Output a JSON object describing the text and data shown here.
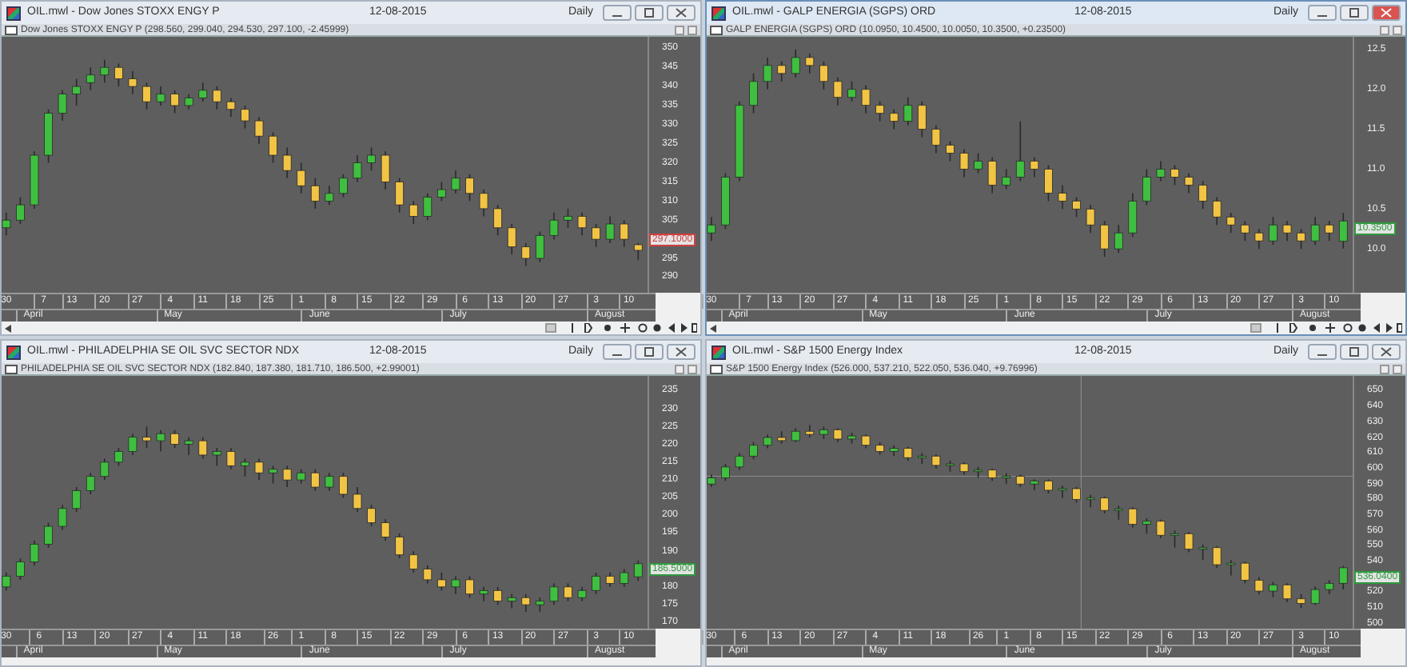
{
  "windows": [
    {
      "title": "OIL.mwl - Dow Jones STOXX ENGY P",
      "date": "12-08-2015",
      "period": "Daily",
      "active": false,
      "series_label": "Dow Jones STOXX ENGY P (298.560, 299.040, 294.530, 297.100, -2.45999)",
      "last_price": "297.1000",
      "chart_data": {
        "type": "candlestick",
        "xlim": [
          "2015-03-29",
          "2015-08-14"
        ],
        "ylim": [
          286,
          353
        ],
        "yticks": [
          {
            "value": 350,
            "label": "350"
          },
          {
            "value": 345,
            "label": "345"
          },
          {
            "value": 340,
            "label": "340"
          },
          {
            "value": 335,
            "label": "335"
          },
          {
            "value": 330,
            "label": "330"
          },
          {
            "value": 325,
            "label": "325"
          },
          {
            "value": 320,
            "label": "320"
          },
          {
            "value": 315,
            "label": "315"
          },
          {
            "value": 310,
            "label": "310"
          },
          {
            "value": 305,
            "label": "305"
          },
          {
            "value": 295,
            "label": "295"
          },
          {
            "value": 290,
            "label": "290"
          }
        ],
        "xticks": [
          {
            "value": "2015-03-30",
            "label": "30"
          },
          {
            "value": "2015-04-07",
            "label": "7"
          },
          {
            "value": "2015-04-13",
            "label": "13"
          },
          {
            "value": "2015-04-20",
            "label": "20"
          },
          {
            "value": "2015-04-27",
            "label": "27"
          },
          {
            "value": "2015-05-04",
            "label": "4"
          },
          {
            "value": "2015-05-11",
            "label": "11"
          },
          {
            "value": "2015-05-18",
            "label": "18"
          },
          {
            "value": "2015-05-25",
            "label": "25"
          },
          {
            "value": "2015-06-01",
            "label": "1"
          },
          {
            "value": "2015-06-08",
            "label": "8"
          },
          {
            "value": "2015-06-15",
            "label": "15"
          },
          {
            "value": "2015-06-22",
            "label": "22"
          },
          {
            "value": "2015-06-29",
            "label": "29"
          },
          {
            "value": "2015-07-06",
            "label": "6"
          },
          {
            "value": "2015-07-13",
            "label": "13"
          },
          {
            "value": "2015-07-20",
            "label": "20"
          },
          {
            "value": "2015-07-27",
            "label": "27"
          },
          {
            "value": "2015-08-03",
            "label": "3"
          },
          {
            "value": "2015-08-10",
            "label": "10"
          }
        ],
        "x": [
          "2015-03-30",
          "2015-04-02",
          "2015-04-05",
          "2015-04-08",
          "2015-04-11",
          "2015-04-14",
          "2015-04-17",
          "2015-04-20",
          "2015-04-23",
          "2015-04-26",
          "2015-04-29",
          "2015-05-02",
          "2015-05-05",
          "2015-05-08",
          "2015-05-11",
          "2015-05-14",
          "2015-05-17",
          "2015-05-20",
          "2015-05-23",
          "2015-05-26",
          "2015-05-29",
          "2015-06-01",
          "2015-06-04",
          "2015-06-07",
          "2015-06-10",
          "2015-06-13",
          "2015-06-16",
          "2015-06-19",
          "2015-06-22",
          "2015-06-25",
          "2015-06-28",
          "2015-07-01",
          "2015-07-04",
          "2015-07-07",
          "2015-07-10",
          "2015-07-13",
          "2015-07-16",
          "2015-07-19",
          "2015-07-22",
          "2015-07-25",
          "2015-07-28",
          "2015-07-31",
          "2015-08-03",
          "2015-08-06",
          "2015-08-09",
          "2015-08-12"
        ],
        "ohlc": [
          [
            303,
            307,
            301,
            305
          ],
          [
            305,
            311,
            304,
            309
          ],
          [
            309,
            323,
            308,
            322
          ],
          [
            322,
            334,
            320,
            333
          ],
          [
            333,
            339,
            331,
            338
          ],
          [
            338,
            342,
            335,
            340
          ],
          [
            341,
            345,
            339,
            343
          ],
          [
            343,
            347,
            341,
            345
          ],
          [
            345,
            346,
            340,
            342
          ],
          [
            342,
            344,
            338,
            340
          ],
          [
            340,
            341,
            334,
            336
          ],
          [
            336,
            340,
            335,
            338
          ],
          [
            338,
            339,
            333,
            335
          ],
          [
            335,
            338,
            334,
            337
          ],
          [
            337,
            341,
            336,
            339
          ],
          [
            339,
            340,
            334,
            336
          ],
          [
            336,
            337,
            332,
            334
          ],
          [
            334,
            335,
            329,
            331
          ],
          [
            331,
            332,
            325,
            327
          ],
          [
            327,
            328,
            320,
            322
          ],
          [
            322,
            324,
            316,
            318
          ],
          [
            318,
            320,
            312,
            314
          ],
          [
            314,
            316,
            308,
            310
          ],
          [
            310,
            314,
            309,
            312
          ],
          [
            312,
            317,
            311,
            316
          ],
          [
            316,
            322,
            315,
            320
          ],
          [
            320,
            324,
            318,
            322
          ],
          [
            322,
            323,
            313,
            315
          ],
          [
            315,
            316,
            307,
            309
          ],
          [
            309,
            310,
            304,
            306
          ],
          [
            306,
            312,
            305,
            311
          ],
          [
            311,
            315,
            310,
            313
          ],
          [
            313,
            318,
            312,
            316
          ],
          [
            316,
            317,
            310,
            312
          ],
          [
            312,
            313,
            306,
            308
          ],
          [
            308,
            309,
            301,
            303
          ],
          [
            303,
            304,
            296,
            298
          ],
          [
            298,
            299,
            293,
            295
          ],
          [
            295,
            302,
            294,
            301
          ],
          [
            301,
            307,
            300,
            305
          ],
          [
            305,
            308,
            303,
            306
          ],
          [
            306,
            307,
            301,
            303
          ],
          [
            303,
            304,
            298,
            300
          ],
          [
            300,
            306,
            299,
            304
          ],
          [
            304,
            305,
            298,
            300
          ],
          [
            298.56,
            299.04,
            294.53,
            297.1
          ]
        ]
      },
      "months": [
        "April",
        "May",
        "June",
        "July",
        "August"
      ]
    },
    {
      "title": "OIL.mwl - GALP ENERGIA (SGPS) ORD",
      "date": "12-08-2015",
      "period": "Daily",
      "active": true,
      "series_label": "GALP ENERGIA (SGPS) ORD (10.0950, 10.4500, 10.0050, 10.3500, +0.23500)",
      "last_price": "10.3500",
      "chart_data": {
        "type": "candlestick",
        "xlim": [
          "2015-03-29",
          "2015-08-14"
        ],
        "ylim": [
          9.45,
          12.66
        ],
        "yticks": [
          {
            "value": 12.5,
            "label": "12.5"
          },
          {
            "value": 12,
            "label": "12.0"
          },
          {
            "value": 11.5,
            "label": "11.5"
          },
          {
            "value": 11,
            "label": "11.0"
          },
          {
            "value": 10.5,
            "label": "10.5"
          },
          {
            "value": 10,
            "label": "10.0"
          }
        ],
        "xticks": [
          {
            "value": "2015-03-30",
            "label": "30"
          },
          {
            "value": "2015-04-07",
            "label": "7"
          },
          {
            "value": "2015-04-13",
            "label": "13"
          },
          {
            "value": "2015-04-20",
            "label": "20"
          },
          {
            "value": "2015-04-27",
            "label": "27"
          },
          {
            "value": "2015-05-04",
            "label": "4"
          },
          {
            "value": "2015-05-11",
            "label": "11"
          },
          {
            "value": "2015-05-18",
            "label": "18"
          },
          {
            "value": "2015-05-25",
            "label": "25"
          },
          {
            "value": "2015-06-01",
            "label": "1"
          },
          {
            "value": "2015-06-08",
            "label": "8"
          },
          {
            "value": "2015-06-15",
            "label": "15"
          },
          {
            "value": "2015-06-22",
            "label": "22"
          },
          {
            "value": "2015-06-29",
            "label": "29"
          },
          {
            "value": "2015-07-06",
            "label": "6"
          },
          {
            "value": "2015-07-13",
            "label": "13"
          },
          {
            "value": "2015-07-20",
            "label": "20"
          },
          {
            "value": "2015-07-27",
            "label": "27"
          },
          {
            "value": "2015-08-03",
            "label": "3"
          },
          {
            "value": "2015-08-10",
            "label": "10"
          }
        ],
        "x": [
          "2015-03-30",
          "2015-04-02",
          "2015-04-05",
          "2015-04-08",
          "2015-04-11",
          "2015-04-14",
          "2015-04-17",
          "2015-04-20",
          "2015-04-23",
          "2015-04-26",
          "2015-04-29",
          "2015-05-02",
          "2015-05-05",
          "2015-05-08",
          "2015-05-11",
          "2015-05-14",
          "2015-05-17",
          "2015-05-20",
          "2015-05-23",
          "2015-05-26",
          "2015-05-29",
          "2015-06-01",
          "2015-06-04",
          "2015-06-07",
          "2015-06-10",
          "2015-06-13",
          "2015-06-16",
          "2015-06-19",
          "2015-06-22",
          "2015-06-25",
          "2015-06-28",
          "2015-07-01",
          "2015-07-04",
          "2015-07-07",
          "2015-07-10",
          "2015-07-13",
          "2015-07-16",
          "2015-07-19",
          "2015-07-22",
          "2015-07-25",
          "2015-07-28",
          "2015-07-31",
          "2015-08-03",
          "2015-08-06",
          "2015-08-09",
          "2015-08-12"
        ],
        "ohlc": [
          [
            10.2,
            10.4,
            10.1,
            10.3
          ],
          [
            10.3,
            10.95,
            10.25,
            10.9
          ],
          [
            10.9,
            11.85,
            10.85,
            11.8
          ],
          [
            11.8,
            12.2,
            11.7,
            12.1
          ],
          [
            12.1,
            12.4,
            12.0,
            12.3
          ],
          [
            12.3,
            12.35,
            12.1,
            12.2
          ],
          [
            12.2,
            12.5,
            12.15,
            12.4
          ],
          [
            12.4,
            12.45,
            12.2,
            12.3
          ],
          [
            12.3,
            12.35,
            12.0,
            12.1
          ],
          [
            12.1,
            12.15,
            11.8,
            11.9
          ],
          [
            11.9,
            12.1,
            11.85,
            12.0
          ],
          [
            12.0,
            12.05,
            11.7,
            11.8
          ],
          [
            11.8,
            11.85,
            11.6,
            11.7
          ],
          [
            11.7,
            11.75,
            11.5,
            11.6
          ],
          [
            11.6,
            11.9,
            11.55,
            11.8
          ],
          [
            11.8,
            11.85,
            11.4,
            11.5
          ],
          [
            11.5,
            11.55,
            11.2,
            11.3
          ],
          [
            11.3,
            11.35,
            11.1,
            11.2
          ],
          [
            11.2,
            11.25,
            10.9,
            11.0
          ],
          [
            11.0,
            11.2,
            10.95,
            11.1
          ],
          [
            11.1,
            11.15,
            10.7,
            10.8
          ],
          [
            10.8,
            11.0,
            10.75,
            10.9
          ],
          [
            10.9,
            11.6,
            10.85,
            11.1
          ],
          [
            11.1,
            11.15,
            10.9,
            11.0
          ],
          [
            11.0,
            11.05,
            10.6,
            10.7
          ],
          [
            10.7,
            10.8,
            10.5,
            10.6
          ],
          [
            10.6,
            10.65,
            10.4,
            10.5
          ],
          [
            10.5,
            10.55,
            10.2,
            10.3
          ],
          [
            10.3,
            10.35,
            9.9,
            10.0
          ],
          [
            10.0,
            10.3,
            9.95,
            10.2
          ],
          [
            10.2,
            10.7,
            10.15,
            10.6
          ],
          [
            10.6,
            11.0,
            10.55,
            10.9
          ],
          [
            10.9,
            11.1,
            10.85,
            11.0
          ],
          [
            11.0,
            11.05,
            10.8,
            10.9
          ],
          [
            10.9,
            10.95,
            10.7,
            10.8
          ],
          [
            10.8,
            10.85,
            10.5,
            10.6
          ],
          [
            10.6,
            10.65,
            10.3,
            10.4
          ],
          [
            10.4,
            10.45,
            10.2,
            10.3
          ],
          [
            10.3,
            10.35,
            10.1,
            10.2
          ],
          [
            10.2,
            10.25,
            10.0,
            10.1
          ],
          [
            10.1,
            10.4,
            10.05,
            10.3
          ],
          [
            10.3,
            10.35,
            10.1,
            10.2
          ],
          [
            10.2,
            10.25,
            10.0,
            10.1
          ],
          [
            10.1,
            10.4,
            10.05,
            10.3
          ],
          [
            10.3,
            10.35,
            10.1,
            10.2
          ],
          [
            10.095,
            10.45,
            10.005,
            10.35
          ]
        ]
      },
      "months": [
        "April",
        "May",
        "June",
        "July",
        "August"
      ]
    },
    {
      "title": "OIL.mwl - PHILADELPHIA SE OIL SVC SECTOR NDX",
      "date": "12-08-2015",
      "period": "Daily",
      "active": false,
      "series_label": "PHILADELPHIA SE OIL SVC SECTOR NDX (182.840, 187.380, 181.710, 186.500, +2.99001)",
      "last_price": "186.5000",
      "chart_data": {
        "type": "candlestick",
        "xlim": [
          "2015-03-29",
          "2015-08-14"
        ],
        "ylim": [
          168.3,
          239.2
        ],
        "yticks": [
          {
            "value": 235,
            "label": "235"
          },
          {
            "value": 230,
            "label": "230"
          },
          {
            "value": 225,
            "label": "225"
          },
          {
            "value": 220,
            "label": "220"
          },
          {
            "value": 215,
            "label": "215"
          },
          {
            "value": 210,
            "label": "210"
          },
          {
            "value": 205,
            "label": "205"
          },
          {
            "value": 200,
            "label": "200"
          },
          {
            "value": 195,
            "label": "195"
          },
          {
            "value": 190,
            "label": "190"
          },
          {
            "value": 180,
            "label": "180"
          },
          {
            "value": 175,
            "label": "175"
          },
          {
            "value": 170,
            "label": "170"
          }
        ],
        "xticks": [
          {
            "value": "2015-03-30",
            "label": "30"
          },
          {
            "value": "2015-04-06",
            "label": "6"
          },
          {
            "value": "2015-04-13",
            "label": "13"
          },
          {
            "value": "2015-04-20",
            "label": "20"
          },
          {
            "value": "2015-04-27",
            "label": "27"
          },
          {
            "value": "2015-05-04",
            "label": "4"
          },
          {
            "value": "2015-05-11",
            "label": "11"
          },
          {
            "value": "2015-05-18",
            "label": "18"
          },
          {
            "value": "2015-05-26",
            "label": "26"
          },
          {
            "value": "2015-06-01",
            "label": "1"
          },
          {
            "value": "2015-06-08",
            "label": "8"
          },
          {
            "value": "2015-06-15",
            "label": "15"
          },
          {
            "value": "2015-06-22",
            "label": "22"
          },
          {
            "value": "2015-06-29",
            "label": "29"
          },
          {
            "value": "2015-07-06",
            "label": "6"
          },
          {
            "value": "2015-07-13",
            "label": "13"
          },
          {
            "value": "2015-07-20",
            "label": "20"
          },
          {
            "value": "2015-07-27",
            "label": "27"
          },
          {
            "value": "2015-08-03",
            "label": "3"
          },
          {
            "value": "2015-08-10",
            "label": "10"
          }
        ],
        "x": [
          "2015-03-30",
          "2015-04-02",
          "2015-04-05",
          "2015-04-08",
          "2015-04-11",
          "2015-04-14",
          "2015-04-17",
          "2015-04-20",
          "2015-04-23",
          "2015-04-26",
          "2015-04-29",
          "2015-05-02",
          "2015-05-05",
          "2015-05-08",
          "2015-05-11",
          "2015-05-14",
          "2015-05-17",
          "2015-05-20",
          "2015-05-23",
          "2015-05-26",
          "2015-05-29",
          "2015-06-01",
          "2015-06-04",
          "2015-06-07",
          "2015-06-10",
          "2015-06-13",
          "2015-06-16",
          "2015-06-19",
          "2015-06-22",
          "2015-06-25",
          "2015-06-28",
          "2015-07-01",
          "2015-07-04",
          "2015-07-07",
          "2015-07-10",
          "2015-07-13",
          "2015-07-16",
          "2015-07-19",
          "2015-07-22",
          "2015-07-25",
          "2015-07-28",
          "2015-07-31",
          "2015-08-03",
          "2015-08-06",
          "2015-08-09",
          "2015-08-12"
        ],
        "ohlc": [
          [
            180,
            184,
            179,
            183
          ],
          [
            183,
            188,
            182,
            187
          ],
          [
            187,
            193,
            186,
            192
          ],
          [
            192,
            198,
            191,
            197
          ],
          [
            197,
            203,
            196,
            202
          ],
          [
            202,
            208,
            201,
            207
          ],
          [
            207,
            212,
            206,
            211
          ],
          [
            211,
            216,
            210,
            215
          ],
          [
            215,
            219,
            214,
            218
          ],
          [
            218,
            223,
            217,
            222
          ],
          [
            222,
            225,
            219,
            221
          ],
          [
            221,
            224,
            218,
            223
          ],
          [
            223,
            224,
            219,
            220
          ],
          [
            220,
            222,
            217,
            221
          ],
          [
            221,
            222,
            216,
            217
          ],
          [
            217,
            219,
            214,
            218
          ],
          [
            218,
            219,
            213,
            214
          ],
          [
            214,
            216,
            211,
            215
          ],
          [
            215,
            216,
            210,
            212
          ],
          [
            212,
            214,
            209,
            213
          ],
          [
            213,
            214,
            208,
            210
          ],
          [
            210,
            213,
            209,
            212
          ],
          [
            212,
            213,
            207,
            208
          ],
          [
            208,
            212,
            207,
            211
          ],
          [
            211,
            212,
            205,
            206
          ],
          [
            206,
            208,
            201,
            202
          ],
          [
            202,
            203,
            197,
            198
          ],
          [
            198,
            199,
            193,
            194
          ],
          [
            194,
            195,
            188,
            189
          ],
          [
            189,
            190,
            184,
            185
          ],
          [
            185,
            186,
            181,
            182
          ],
          [
            182,
            184,
            179,
            180
          ],
          [
            180,
            183,
            178,
            182
          ],
          [
            182,
            183,
            177,
            178
          ],
          [
            178,
            180,
            176,
            179
          ],
          [
            179,
            180,
            175,
            176
          ],
          [
            176,
            178,
            174,
            177
          ],
          [
            177,
            178,
            173,
            175
          ],
          [
            175,
            177,
            173,
            176
          ],
          [
            176,
            181,
            175,
            180
          ],
          [
            180,
            181,
            176,
            177
          ],
          [
            177,
            180,
            176,
            179
          ],
          [
            179,
            184,
            178,
            183
          ],
          [
            183,
            184,
            180,
            181
          ],
          [
            181,
            185,
            180,
            184
          ],
          [
            182.84,
            187.38,
            181.71,
            186.5
          ]
        ]
      },
      "months": [
        "April",
        "May",
        "June",
        "July",
        "August"
      ]
    },
    {
      "title": "OIL.mwl - S&P 1500 Energy Index",
      "date": "12-08-2015",
      "period": "Daily",
      "active": false,
      "series_label": "S&P 1500 Energy Index (526.000, 537.210, 522.050, 536.040, +9.76996)",
      "last_price": "536.0400",
      "chart_data": {
        "type": "candlestick",
        "xlim": [
          "2015-03-29",
          "2015-08-14"
        ],
        "ylim": [
          496.8,
          659.7
        ],
        "yticks": [
          {
            "value": 650,
            "label": "650"
          },
          {
            "value": 640,
            "label": "640"
          },
          {
            "value": 630,
            "label": "630"
          },
          {
            "value": 620,
            "label": "620"
          },
          {
            "value": 610,
            "label": "610"
          },
          {
            "value": 600,
            "label": "600"
          },
          {
            "value": 590,
            "label": "590"
          },
          {
            "value": 580,
            "label": "580"
          },
          {
            "value": 570,
            "label": "570"
          },
          {
            "value": 560,
            "label": "560"
          },
          {
            "value": 550,
            "label": "550"
          },
          {
            "value": 540,
            "label": "540"
          },
          {
            "value": 520,
            "label": "520"
          },
          {
            "value": 510,
            "label": "510"
          },
          {
            "value": 500,
            "label": "500"
          }
        ],
        "xticks": [
          {
            "value": "2015-03-30",
            "label": "30"
          },
          {
            "value": "2015-04-06",
            "label": "6"
          },
          {
            "value": "2015-04-13",
            "label": "13"
          },
          {
            "value": "2015-04-20",
            "label": "20"
          },
          {
            "value": "2015-04-27",
            "label": "27"
          },
          {
            "value": "2015-05-04",
            "label": "4"
          },
          {
            "value": "2015-05-11",
            "label": "11"
          },
          {
            "value": "2015-05-18",
            "label": "18"
          },
          {
            "value": "2015-05-26",
            "label": "26"
          },
          {
            "value": "2015-06-01",
            "label": "1"
          },
          {
            "value": "2015-06-08",
            "label": "8"
          },
          {
            "value": "2015-06-15",
            "label": "15"
          },
          {
            "value": "2015-06-22",
            "label": "22"
          },
          {
            "value": "2015-06-29",
            "label": "29"
          },
          {
            "value": "2015-07-06",
            "label": "6"
          },
          {
            "value": "2015-07-13",
            "label": "13"
          },
          {
            "value": "2015-07-20",
            "label": "20"
          },
          {
            "value": "2015-07-27",
            "label": "27"
          },
          {
            "value": "2015-08-03",
            "label": "3"
          },
          {
            "value": "2015-08-10",
            "label": "10"
          }
        ],
        "x": [
          "2015-03-30",
          "2015-04-02",
          "2015-04-05",
          "2015-04-08",
          "2015-04-11",
          "2015-04-14",
          "2015-04-17",
          "2015-04-20",
          "2015-04-23",
          "2015-04-26",
          "2015-04-29",
          "2015-05-02",
          "2015-05-05",
          "2015-05-08",
          "2015-05-11",
          "2015-05-14",
          "2015-05-17",
          "2015-05-20",
          "2015-05-23",
          "2015-05-26",
          "2015-05-29",
          "2015-06-01",
          "2015-06-04",
          "2015-06-07",
          "2015-06-10",
          "2015-06-13",
          "2015-06-16",
          "2015-06-19",
          "2015-06-22",
          "2015-06-25",
          "2015-06-28",
          "2015-07-01",
          "2015-07-04",
          "2015-07-07",
          "2015-07-10",
          "2015-07-13",
          "2015-07-16",
          "2015-07-19",
          "2015-07-22",
          "2015-07-25",
          "2015-07-28",
          "2015-07-31",
          "2015-08-03",
          "2015-08-06",
          "2015-08-09",
          "2015-08-12"
        ],
        "ref_lines": [
          {
            "axis": "x",
            "value": "2015-06-17"
          },
          {
            "axis": "y",
            "value": 595
          }
        ],
        "ohlc": [
          [
            590,
            596,
            588,
            594
          ],
          [
            594,
            603,
            592,
            601
          ],
          [
            601,
            610,
            599,
            608
          ],
          [
            608,
            617,
            606,
            615
          ],
          [
            615,
            622,
            613,
            620
          ],
          [
            620,
            624,
            616,
            618
          ],
          [
            618,
            626,
            617,
            624
          ],
          [
            624,
            628,
            620,
            622
          ],
          [
            622,
            627,
            619,
            625
          ],
          [
            625,
            626,
            617,
            619
          ],
          [
            619,
            623,
            616,
            621
          ],
          [
            621,
            622,
            613,
            615
          ],
          [
            615,
            617,
            609,
            611
          ],
          [
            611,
            615,
            608,
            613
          ],
          [
            613,
            614,
            605,
            607
          ],
          [
            607,
            610,
            603,
            608
          ],
          [
            608,
            609,
            600,
            602
          ],
          [
            602,
            605,
            598,
            603
          ],
          [
            603,
            604,
            596,
            598
          ],
          [
            598,
            601,
            594,
            599
          ],
          [
            599,
            600,
            592,
            594
          ],
          [
            594,
            597,
            590,
            595
          ],
          [
            595,
            596,
            588,
            590
          ],
          [
            590,
            593,
            586,
            592
          ],
          [
            592,
            593,
            584,
            586
          ],
          [
            586,
            589,
            581,
            587
          ],
          [
            587,
            588,
            578,
            580
          ],
          [
            580,
            583,
            575,
            581
          ],
          [
            581,
            582,
            571,
            573
          ],
          [
            573,
            576,
            567,
            574
          ],
          [
            574,
            575,
            562,
            564
          ],
          [
            564,
            568,
            558,
            566
          ],
          [
            566,
            567,
            555,
            557
          ],
          [
            557,
            560,
            549,
            558
          ],
          [
            558,
            559,
            546,
            548
          ],
          [
            548,
            551,
            541,
            549
          ],
          [
            549,
            550,
            536,
            538
          ],
          [
            538,
            541,
            531,
            539
          ],
          [
            539,
            540,
            526,
            528
          ],
          [
            528,
            530,
            519,
            521
          ],
          [
            521,
            527,
            517,
            525
          ],
          [
            525,
            526,
            514,
            516
          ],
          [
            516,
            519,
            510,
            513
          ],
          [
            513,
            524,
            512,
            522
          ],
          [
            522,
            528,
            519,
            526
          ],
          [
            526,
            537.21,
            522.05,
            536.04
          ]
        ]
      },
      "months": [
        "April",
        "May",
        "June",
        "July",
        "August"
      ]
    }
  ]
}
